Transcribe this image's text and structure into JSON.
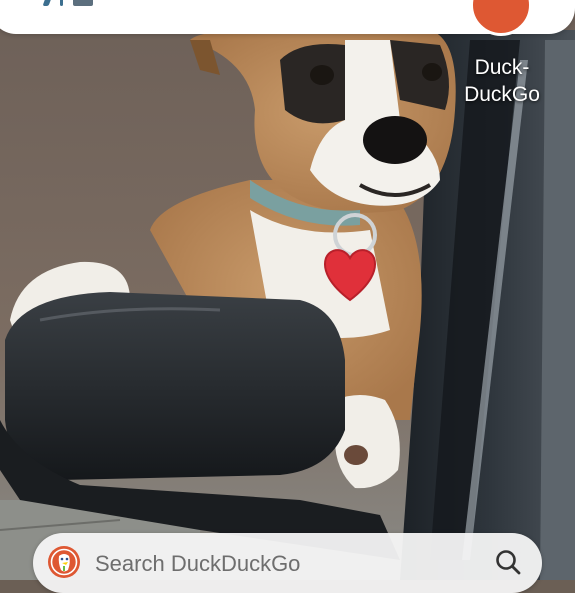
{
  "home_screen": {
    "wallpaper": {
      "subject": "boxer-dog-looking-out-car-window",
      "tag_color": "#e0303a",
      "collar_color": "#7aa0a0"
    },
    "status_icons": [
      "navigation-icon",
      "network-icon",
      "app-icon"
    ],
    "apps": [
      {
        "label_line1": "Duck-",
        "label_line2": "DuckGo",
        "icon": "duckduckgo-logo-icon",
        "color": "#de5833"
      }
    ],
    "search_widget": {
      "placeholder": "Search DuckDuckGo",
      "logo": "duckduckgo-logo-icon",
      "search_icon": "search-icon",
      "background": "#f6f6f6"
    }
  }
}
